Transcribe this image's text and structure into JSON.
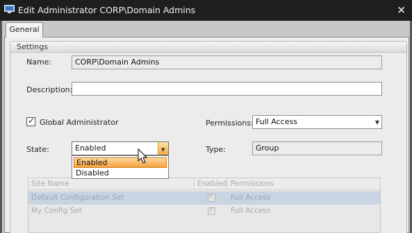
{
  "window": {
    "title": "Edit Administrator CORP\\Domain Admins",
    "close_glyph": "×"
  },
  "tabs": [
    {
      "label": "General"
    }
  ],
  "settings": {
    "group_title": "Settings",
    "name_label": "Name:",
    "name_value": "CORP\\Domain Admins",
    "description_label": "Description:",
    "description_value": "",
    "global_admin_label": "Global Administrator",
    "global_admin_checked": true,
    "permissions_label": "Permissions:",
    "permissions_value": "Full Access",
    "state_label": "State:",
    "state_value": "Enabled",
    "type_label": "Type:",
    "type_value": "Group"
  },
  "state_dropdown": {
    "options": [
      "Enabled",
      "Disabled"
    ],
    "selected": "Enabled"
  },
  "grid": {
    "columns": [
      "Site Name",
      "Enabled",
      "Permissions"
    ],
    "rows": [
      {
        "site_name": "Default Configuration Set",
        "enabled": true,
        "permissions": "Full Access",
        "selected": true
      },
      {
        "site_name": "My Config Set",
        "enabled": true,
        "permissions": "Full Access",
        "selected": false
      }
    ]
  },
  "colors": {
    "accent": "#f3a93a",
    "titlebar": "#1e1e1e",
    "selection": "#c9d4e3"
  }
}
